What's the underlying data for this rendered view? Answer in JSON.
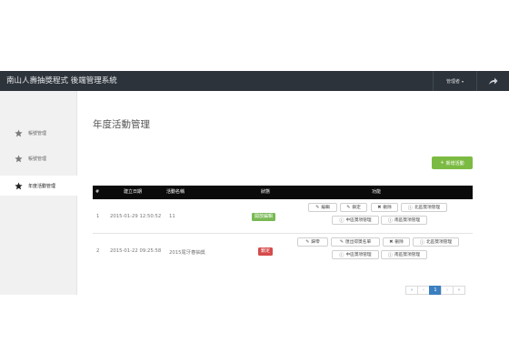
{
  "navbar": {
    "brand": "南山人壽抽獎程式 後端管理系統",
    "user_label": "管理者",
    "user_caret": "▾",
    "logout_icon": "share-arrow-icon"
  },
  "sidebar": {
    "items": [
      {
        "label": "帳號管理",
        "icon": "star-icon"
      },
      {
        "label": "帳號管理",
        "icon": "star-icon"
      },
      {
        "label": "年度活動管理",
        "icon": "star-icon"
      }
    ]
  },
  "page": {
    "title": "年度活動管理",
    "add_button": "新增活動",
    "add_button_icon": "+"
  },
  "table": {
    "headers": [
      "#",
      "建立日期",
      "活動名稱",
      "狀態",
      "功能"
    ],
    "rows": [
      {
        "index": "1",
        "date": "2015-01-29 12:50:52",
        "name": "11",
        "status": "開放編輯",
        "actions": [
          "編輯",
          "鎖定",
          "刪除",
          "北區獎項管理",
          "中區獎項管理",
          "南區獎項管理"
        ]
      },
      {
        "index": "2",
        "date": "2015-01-22 09:25:58",
        "name": "2015尾牙春抽獎",
        "status": "鎖定",
        "actions": [
          "歸零",
          "匯出得獎名單",
          "刪除",
          "北區獎項管理",
          "中區獎項管理",
          "南區獎項管理"
        ]
      }
    ]
  },
  "pager": {
    "first": "«",
    "prev": "‹",
    "current": "1",
    "next": "›",
    "last": "»"
  },
  "colors": {
    "navbar": "#2c333b",
    "add_button": "#7cbb43",
    "status_open": "#79b954",
    "status_locked": "#d64b4b",
    "pager_active": "#3a7fc1"
  }
}
